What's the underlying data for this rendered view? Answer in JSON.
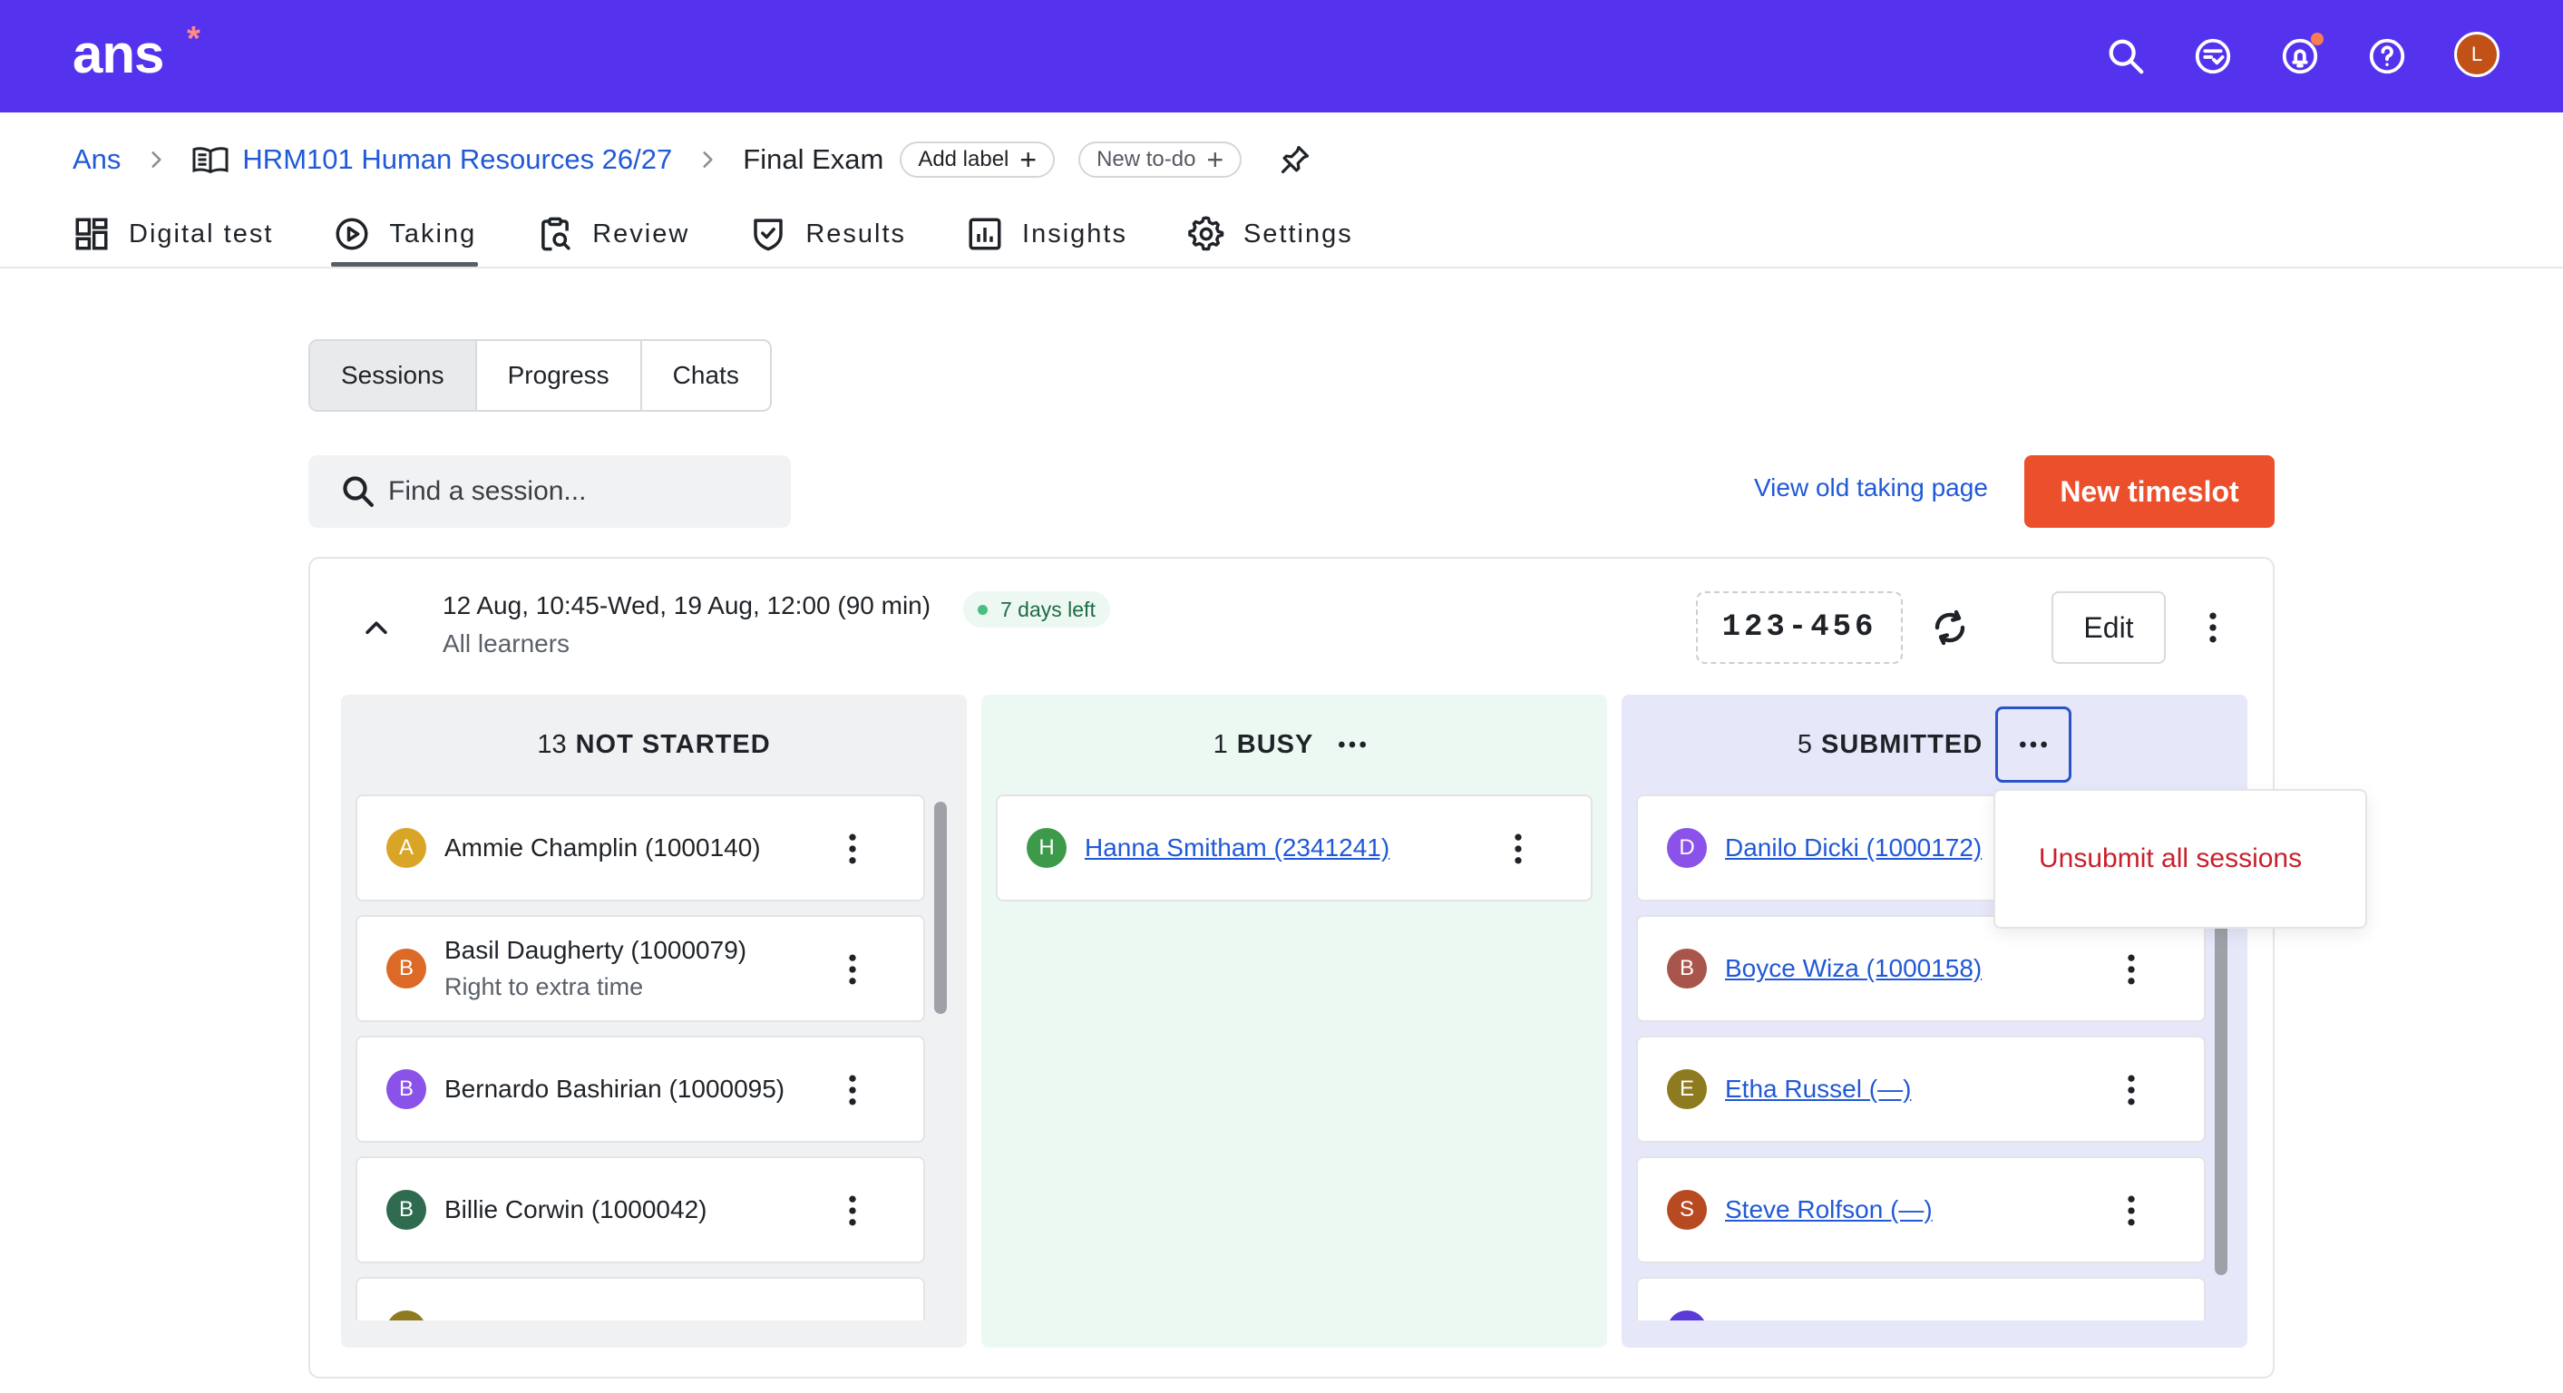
{
  "header": {
    "logo_text": "ans",
    "logo_mark": "*",
    "icons": [
      "search-icon",
      "todo-icon",
      "bell-icon",
      "help-icon"
    ],
    "user_initial": "L"
  },
  "breadcrumb": {
    "root": "Ans",
    "course": "HRM101 Human Resources 26/27",
    "current": "Final Exam",
    "add_label": "Add label",
    "new_todo": "New to-do"
  },
  "nav": {
    "items": [
      {
        "label": "Digital test",
        "icon": "grid-icon"
      },
      {
        "label": "Taking",
        "icon": "play-icon",
        "active": true
      },
      {
        "label": "Review",
        "icon": "clipboard-search-icon"
      },
      {
        "label": "Results",
        "icon": "shield-check-icon"
      },
      {
        "label": "Insights",
        "icon": "chart-icon"
      },
      {
        "label": "Settings",
        "icon": "gear-icon"
      }
    ]
  },
  "subtabs": [
    "Sessions",
    "Progress",
    "Chats"
  ],
  "search": {
    "placeholder": "Find a session..."
  },
  "actions": {
    "old_page_link": "View old taking page",
    "new_timeslot": "New timeslot"
  },
  "timeslot": {
    "time": "12 Aug, 10:45-Wed, 19 Aug, 12:00 (90 min)",
    "badge": "7 days left",
    "audience": "All learners",
    "code": "123-456",
    "edit_label": "Edit"
  },
  "columns": {
    "not_started": {
      "count": "13",
      "label": "NOT STARTED",
      "rows": [
        {
          "initial": "A",
          "color": "#d9a526",
          "name": "Ammie Champlin (1000140)"
        },
        {
          "initial": "B",
          "color": "#dc6a26",
          "name": "Basil Daugherty (1000079)",
          "sub": "Right to extra time"
        },
        {
          "initial": "B",
          "color": "#8a52e8",
          "name": "Bernardo Bashirian (1000095)"
        },
        {
          "initial": "B",
          "color": "#2f6b4f",
          "name": "Billie Corwin (1000042)"
        }
      ]
    },
    "busy": {
      "count": "1",
      "label": "BUSY",
      "rows": [
        {
          "initial": "H",
          "color": "#3d9a4b",
          "name": "Hanna Smitham (2341241)"
        }
      ]
    },
    "submitted": {
      "count": "5",
      "label": "SUBMITTED",
      "rows": [
        {
          "initial": "D",
          "color": "#8a52e8",
          "name": "Danilo Dicki (1000172)"
        },
        {
          "initial": "B",
          "color": "#a8564c",
          "name": "Boyce Wiza (1000158)"
        },
        {
          "initial": "E",
          "color": "#8f7b1f",
          "name": "Etha Russel (—)"
        },
        {
          "initial": "S",
          "color": "#b84a22",
          "name": "Steve Rolfson (—)"
        }
      ]
    }
  },
  "dropdown": {
    "unsubmit_all": "Unsubmit all sessions"
  },
  "colors": {
    "brand": "#5533ee",
    "primary_button": "#ec4f2c",
    "link": "#2159d6",
    "danger": "#c8202c"
  }
}
